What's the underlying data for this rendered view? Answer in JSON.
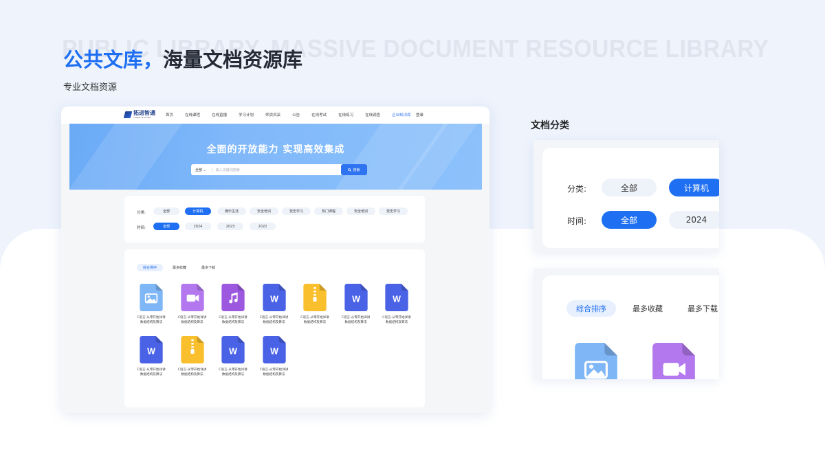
{
  "header": {
    "watermark": "PUBLIC LIBRARY, MASSIVE DOCUMENT RESOURCE LIBRARY",
    "title_accent": "公共文库，",
    "title_rest": "海量文档资源库",
    "subtitle": "专业文档资源"
  },
  "mockup": {
    "logo_text": "拓进智通",
    "logo_sub": "TUOJIN ZHITONG",
    "nav": [
      "首页",
      "在线课程",
      "在线直播",
      "学习计划",
      "师资风采",
      "公告",
      "在线考试",
      "在线练习",
      "在线调查",
      "企业知识库"
    ],
    "nav_active_index": 9,
    "login": "登录",
    "banner_title": "全面的开放能力  实现高效集成",
    "search": {
      "scope": "全部",
      "placeholder": "输入关键词搜索",
      "button": "搜索"
    },
    "filters": {
      "category_label": "分类:",
      "categories": [
        "全部",
        "计算机",
        "娱乐生活",
        "安全培训",
        "党史学习",
        "热门课程",
        "安全培训",
        "党史学习"
      ],
      "category_active": 1,
      "time_label": "时间:",
      "times": [
        "全部",
        "2024",
        "2023",
        "2022"
      ],
      "time_active": 0
    },
    "sort_tabs": [
      "综合排序",
      "最多收藏",
      "最多下载"
    ],
    "sort_active": 0,
    "files": [
      {
        "type": "image-icon",
        "name_line1": "C语言-从零开始详讲",
        "name_line2": "数据结构及算法"
      },
      {
        "type": "video-icon",
        "name_line1": "C语言-从零开始详讲",
        "name_line2": "数据结构及算法"
      },
      {
        "type": "music-icon",
        "name_line1": "C语言-从零开始详讲",
        "name_line2": "数据结构及算法"
      },
      {
        "type": "word-icon",
        "name_line1": "C语言-从零开始详讲",
        "name_line2": "数据结构及算法"
      },
      {
        "type": "zip-icon",
        "name_line1": "C语言-从零开始详讲",
        "name_line2": "数据结构及算法"
      },
      {
        "type": "word-icon",
        "name_line1": "C语言-从零开始详讲",
        "name_line2": "数据结构及算法"
      },
      {
        "type": "word-icon",
        "name_line1": "C语言-从零开始详讲",
        "name_line2": "数据结构及算法"
      },
      {
        "type": "word-icon",
        "name_line1": "C语言-从零开始详讲",
        "name_line2": "数据结构及算法"
      },
      {
        "type": "zip-icon",
        "name_line1": "C语言-从零开始详讲",
        "name_line2": "数据结构及算法"
      },
      {
        "type": "word-icon",
        "name_line1": "C语言-从零开始详讲",
        "name_line2": "数据结构及算法"
      },
      {
        "type": "word-icon",
        "name_line1": "C语言-从零开始详讲",
        "name_line2": "数据结构及算法"
      }
    ]
  },
  "detail": {
    "section_label": "文档分类",
    "category_label": "分类:",
    "categories": [
      "全部",
      "计算机"
    ],
    "time_label": "时间:",
    "times": [
      "全部",
      "2024"
    ],
    "sort_tabs": [
      "综合排序",
      "最多收藏",
      "最多下载"
    ]
  },
  "colors": {
    "accent": "#1e6ff2",
    "word": "#4a63e6",
    "zip": "#f9bf2c",
    "video": "#b378ee",
    "music": "#9c59e0",
    "image": "#7fb6f6"
  }
}
